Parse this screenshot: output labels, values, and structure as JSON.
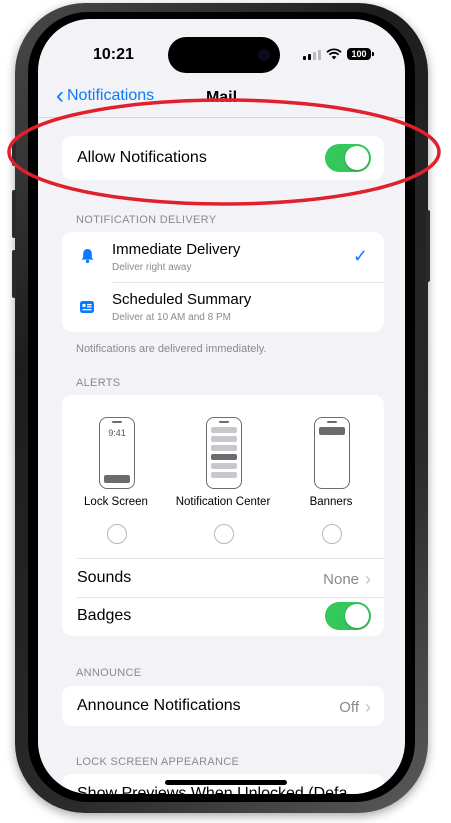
{
  "status_bar": {
    "time": "10:21",
    "battery": "100"
  },
  "nav": {
    "back_label": "Notifications",
    "title": "Mail"
  },
  "allow_notifications": {
    "label": "Allow Notifications",
    "enabled": true
  },
  "notification_delivery": {
    "header": "NOTIFICATION DELIVERY",
    "options": [
      {
        "title": "Immediate Delivery",
        "subtitle": "Deliver right away",
        "icon": "bell-icon",
        "selected": true
      },
      {
        "title": "Scheduled Summary",
        "subtitle": "Deliver at 10 AM and 8 PM",
        "icon": "summary-icon",
        "selected": false
      }
    ],
    "footer": "Notifications are delivered immediately."
  },
  "alerts": {
    "header": "ALERTS",
    "styles": [
      {
        "label": "Lock Screen",
        "preview_time": "9:41"
      },
      {
        "label": "Notification Center"
      },
      {
        "label": "Banners"
      }
    ],
    "sounds": {
      "label": "Sounds",
      "value": "None"
    },
    "badges": {
      "label": "Badges",
      "enabled": true
    }
  },
  "announce": {
    "header": "ANNOUNCE",
    "row": {
      "label": "Announce Notifications",
      "value": "Off"
    }
  },
  "lock_screen_appearance": {
    "header": "LOCK SCREEN APPEARANCE",
    "row_partial": "Show Previews  When Unlocked (Defa"
  },
  "colors": {
    "accent": "#0a7aff",
    "toggle_on": "#34c759",
    "annotation": "#e0202a"
  }
}
